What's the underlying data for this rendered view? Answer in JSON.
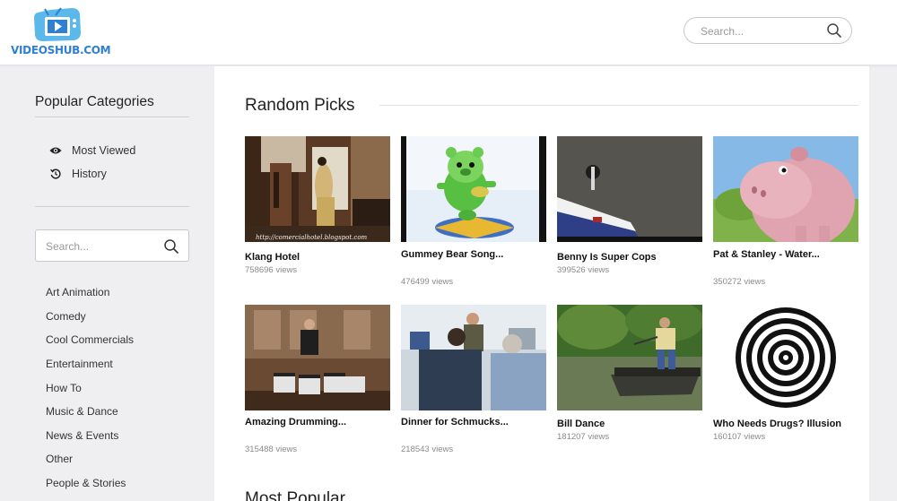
{
  "header": {
    "logo_text": "VIDEOSHUB.COM",
    "search_placeholder": "Search..."
  },
  "sidebar": {
    "heading": "Popular Categories",
    "nav": [
      {
        "label": "Most Viewed",
        "icon": "eye-icon"
      },
      {
        "label": "History",
        "icon": "history-icon"
      }
    ],
    "search_placeholder": "Search...",
    "categories": [
      "Art Animation",
      "Comedy",
      "Cool Commercials",
      "Entertainment",
      "How To",
      "Music & Dance",
      "News & Events",
      "Other",
      "People & Stories"
    ]
  },
  "main": {
    "section_title": "Random Picks",
    "next_section_title": "Most Popular",
    "videos": [
      {
        "title": "Klang Hotel",
        "views": "758696 views",
        "watermark": "http://comercialhotel.blogspot.com"
      },
      {
        "title": "Gummey Bear Song...",
        "views": "476499 views"
      },
      {
        "title": "Benny Is Super Cops",
        "views": "399526 views"
      },
      {
        "title": "Pat & Stanley - Water...",
        "views": "350272 views"
      },
      {
        "title": "Amazing Drumming...",
        "views": "315488 views"
      },
      {
        "title": "Dinner for Schmucks...",
        "views": "218543 views"
      },
      {
        "title": "Bill Dance",
        "views": "181207 views"
      },
      {
        "title": "Who Needs Drugs? Illusion",
        "views": "160107 views"
      }
    ]
  },
  "colors": {
    "brand": "#2f7fd4",
    "sidebar_bg": "#efeff1",
    "main_bg": "#ffffff"
  }
}
